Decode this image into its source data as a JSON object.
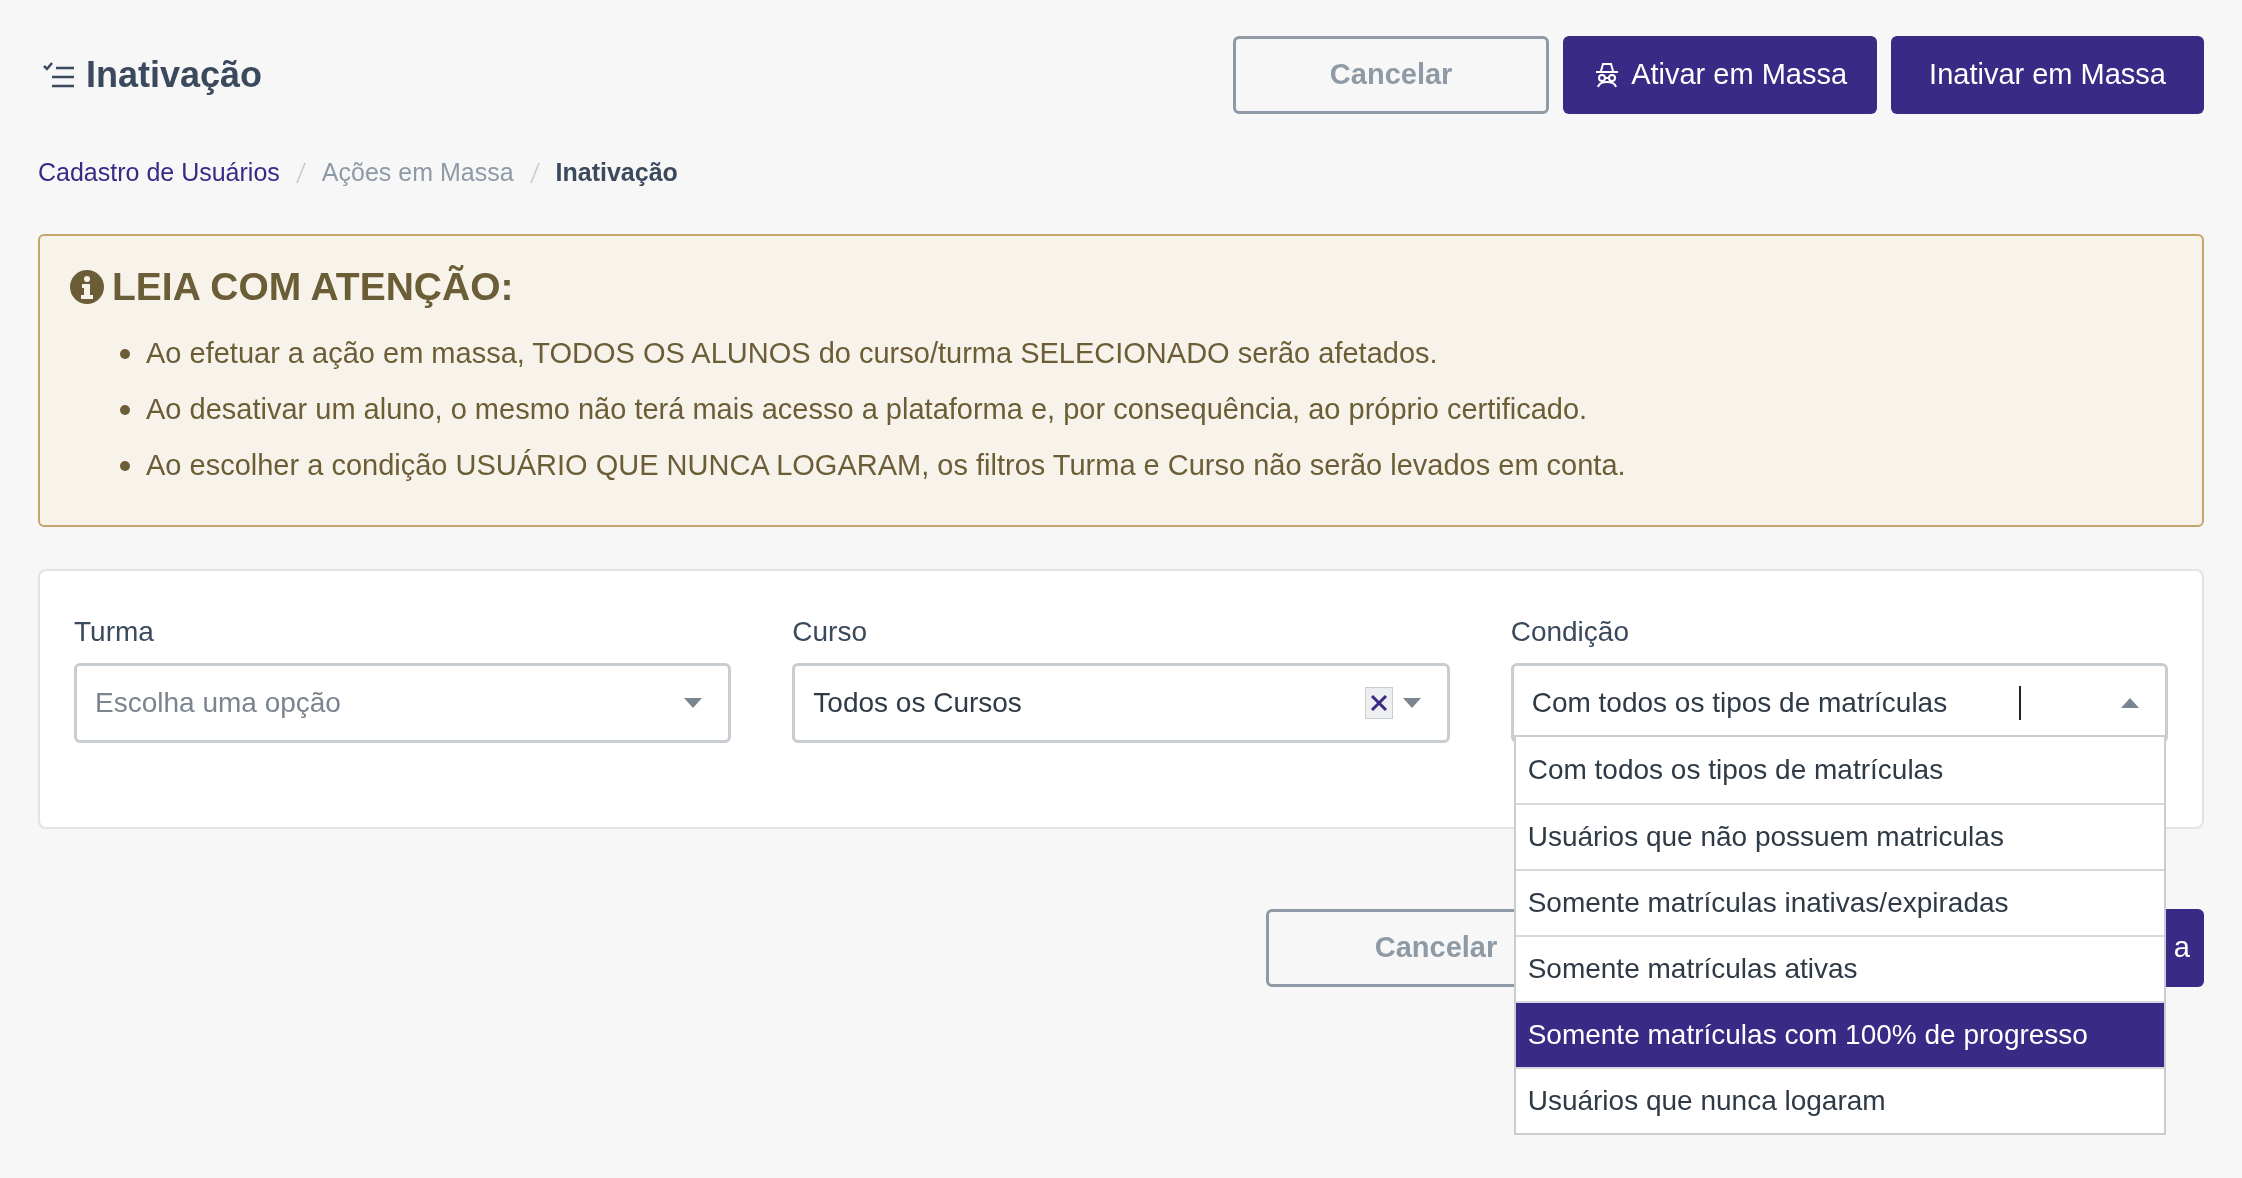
{
  "header": {
    "title": "Inativação",
    "buttons": [
      {
        "label": "Cancelar",
        "kind": "outline"
      },
      {
        "label": "Ativar em Massa",
        "kind": "primary_icon"
      },
      {
        "label": "Inativar em Massa",
        "kind": "primary"
      }
    ]
  },
  "breadcrumb": [
    {
      "label": "Cadastro de Usuários",
      "kind": "link"
    },
    {
      "label": "Ações em Massa",
      "kind": "muted"
    },
    {
      "label": "Inativação",
      "kind": "current"
    }
  ],
  "alert": {
    "title": "LEIA COM ATENÇÃO:",
    "items": [
      "Ao efetuar a ação em massa, TODOS OS ALUNOS do curso/turma SELECIONADO serão afetados.",
      "Ao desativar um aluno, o mesmo não terá mais acesso a plataforma e, por consequência, ao próprio certificado.",
      "Ao escolher a condição USUÁRIO QUE NUNCA LOGARAM, os filtros Turma e Curso não serão levados em conta."
    ]
  },
  "filters": [
    {
      "label": "Turma",
      "placeholder": "Escolha uma opção",
      "clearable": false,
      "expanded": false
    },
    {
      "label": "Curso",
      "value": "Todos os Cursos",
      "clearable": true,
      "expanded": false
    },
    {
      "label": "Condição",
      "value": "Com todos os tipos de matrículas",
      "clearable": false,
      "expanded": true,
      "options": [
        {
          "label": "Com todos os tipos de matrículas",
          "highlighted": false
        },
        {
          "label": "Usuários que não possuem matriculas",
          "highlighted": false
        },
        {
          "label": "Somente matrículas inativas/expiradas",
          "highlighted": false
        },
        {
          "label": "Somente matrículas ativas",
          "highlighted": false
        },
        {
          "label": "Somente matrículas com 100% de progresso",
          "highlighted": true
        },
        {
          "label": "Usuários que nunca logaram",
          "highlighted": false
        }
      ]
    }
  ],
  "footer_buttons": [
    {
      "label": "Cancelar",
      "kind": "outline"
    },
    {
      "label": "a",
      "kind": "primary"
    }
  ]
}
